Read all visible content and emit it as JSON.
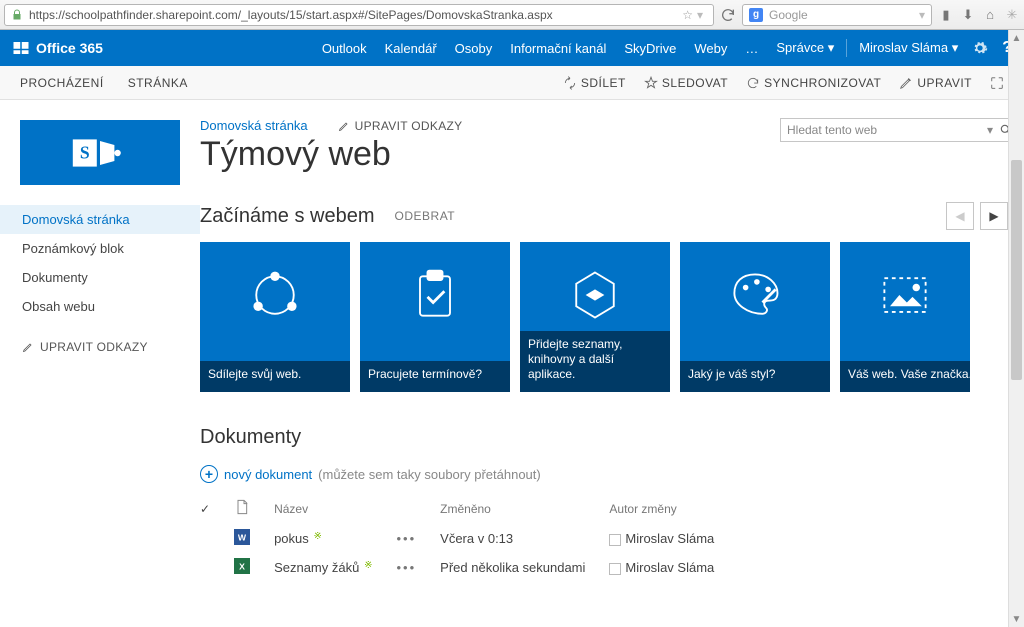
{
  "browser": {
    "url": "https://schoolpathfinder.sharepoint.com/_layouts/15/start.aspx#/SitePages/DomovskaStranka.aspx",
    "search_placeholder": "Google"
  },
  "suite": {
    "product": "Office 365",
    "nav": {
      "outlook": "Outlook",
      "calendar": "Kalendář",
      "people": "Osoby",
      "newsfeed": "Informační kanál",
      "skydrive": "SkyDrive",
      "sites": "Weby",
      "more": "…",
      "admin": "Správce"
    },
    "user": "Miroslav Sláma"
  },
  "ribbon": {
    "browse": "PROCHÁZENÍ",
    "page": "STRÁNKA",
    "share": "SDÍLET",
    "follow": "SLEDOVAT",
    "sync": "SYNCHRONIZOVAT",
    "edit": "UPRAVIT"
  },
  "leftnav": {
    "items": [
      {
        "label": "Domovská stránka"
      },
      {
        "label": "Poznámkový blok"
      },
      {
        "label": "Dokumenty"
      },
      {
        "label": "Obsah webu"
      }
    ],
    "edit": "UPRAVIT ODKAZY"
  },
  "breadcrumb": {
    "home": "Domovská stránka",
    "edit_links": "UPRAVIT ODKAZY"
  },
  "search": {
    "placeholder": "Hledat tento web"
  },
  "title": "Týmový web",
  "getting_started": {
    "heading": "Začínáme s webem",
    "remove": "ODEBRAT",
    "tiles": [
      {
        "caption": "Sdílejte svůj web."
      },
      {
        "caption": "Pracujete termínově?"
      },
      {
        "caption": "Přidejte seznamy, knihovny a další aplikace."
      },
      {
        "caption": "Jaký je váš styl?"
      },
      {
        "caption": "Váš web. Vaše značka."
      }
    ]
  },
  "docs": {
    "heading": "Dokumenty",
    "new_label": "nový dokument",
    "new_hint": "(můžete sem taky soubory přetáhnout)",
    "columns": {
      "name": "Název",
      "modified": "Změněno",
      "modified_by": "Autor změny"
    },
    "rows": [
      {
        "icon": "word",
        "name": "pokus",
        "modified": "Včera v 0:13",
        "by": "Miroslav Sláma"
      },
      {
        "icon": "excel",
        "name": "Seznamy žáků",
        "modified": "Před několika sekundami",
        "by": "Miroslav Sláma"
      }
    ]
  }
}
